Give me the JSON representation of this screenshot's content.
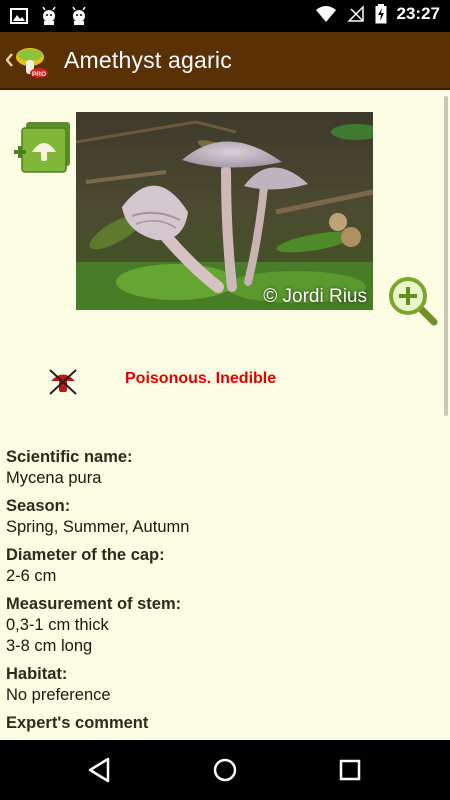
{
  "status_bar": {
    "time": "23:27",
    "icons": [
      "image-icon",
      "android-debug-icon",
      "android-debug-icon",
      "wifi-icon",
      "no-signal-icon",
      "battery-charging-icon"
    ]
  },
  "app_bar": {
    "title": "Amethyst agaric",
    "logo_badge": "PRO"
  },
  "photo": {
    "credit": "© Jordi Rius"
  },
  "toxicity": {
    "label": "Poisonous. Inedible",
    "color": "#e00000"
  },
  "fields": [
    {
      "label": "Scientific name:",
      "value": "Mycena pura"
    },
    {
      "label": "Season:",
      "value": "Spring, Summer, Autumn"
    },
    {
      "label": "Diameter of the cap:",
      "value": "2-6 cm"
    },
    {
      "label": "Measurement of stem:",
      "value": "0,3-1 cm thick\n3-8 cm long"
    },
    {
      "label": "Habitat:",
      "value": "No preference"
    },
    {
      "label": "Expert's comment",
      "value": ""
    }
  ],
  "colors": {
    "app_bar": "#5a3005",
    "background": "#fdfde3",
    "accent_green": "#6aa92a"
  }
}
